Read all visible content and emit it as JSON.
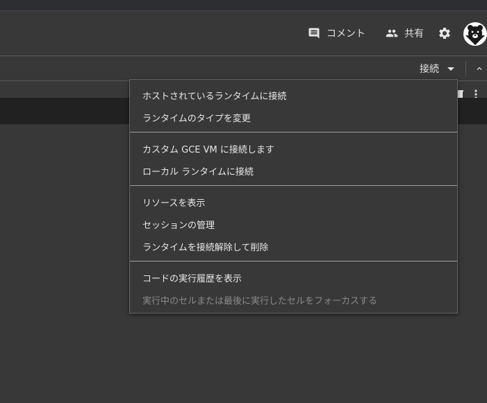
{
  "header": {
    "comment_label": "コメント",
    "share_label": "共有"
  },
  "toolbar": {
    "connect_label": "接続"
  },
  "menu": {
    "items": [
      {
        "label": "ホストされているランタイムに接続",
        "enabled": true
      },
      {
        "label": "ランタイムのタイプを変更",
        "enabled": true
      },
      {
        "label": "カスタム GCE VM に接続します",
        "enabled": true
      },
      {
        "label": "ローカル ランタイムに接続",
        "enabled": true
      },
      {
        "label": "リソースを表示",
        "enabled": true
      },
      {
        "label": "セッションの管理",
        "enabled": true
      },
      {
        "label": "ランタイムを接続解除して削除",
        "enabled": true
      },
      {
        "label": "コードの実行履歴を表示",
        "enabled": true
      },
      {
        "label": "実行中のセルまたは最後に実行したセルをフォーカスする",
        "enabled": false
      }
    ]
  },
  "colors": {
    "background": "#383838",
    "menu_border": "#5f6368",
    "separator": "#9aa0a6",
    "disabled_text": "#8a8a8a"
  }
}
